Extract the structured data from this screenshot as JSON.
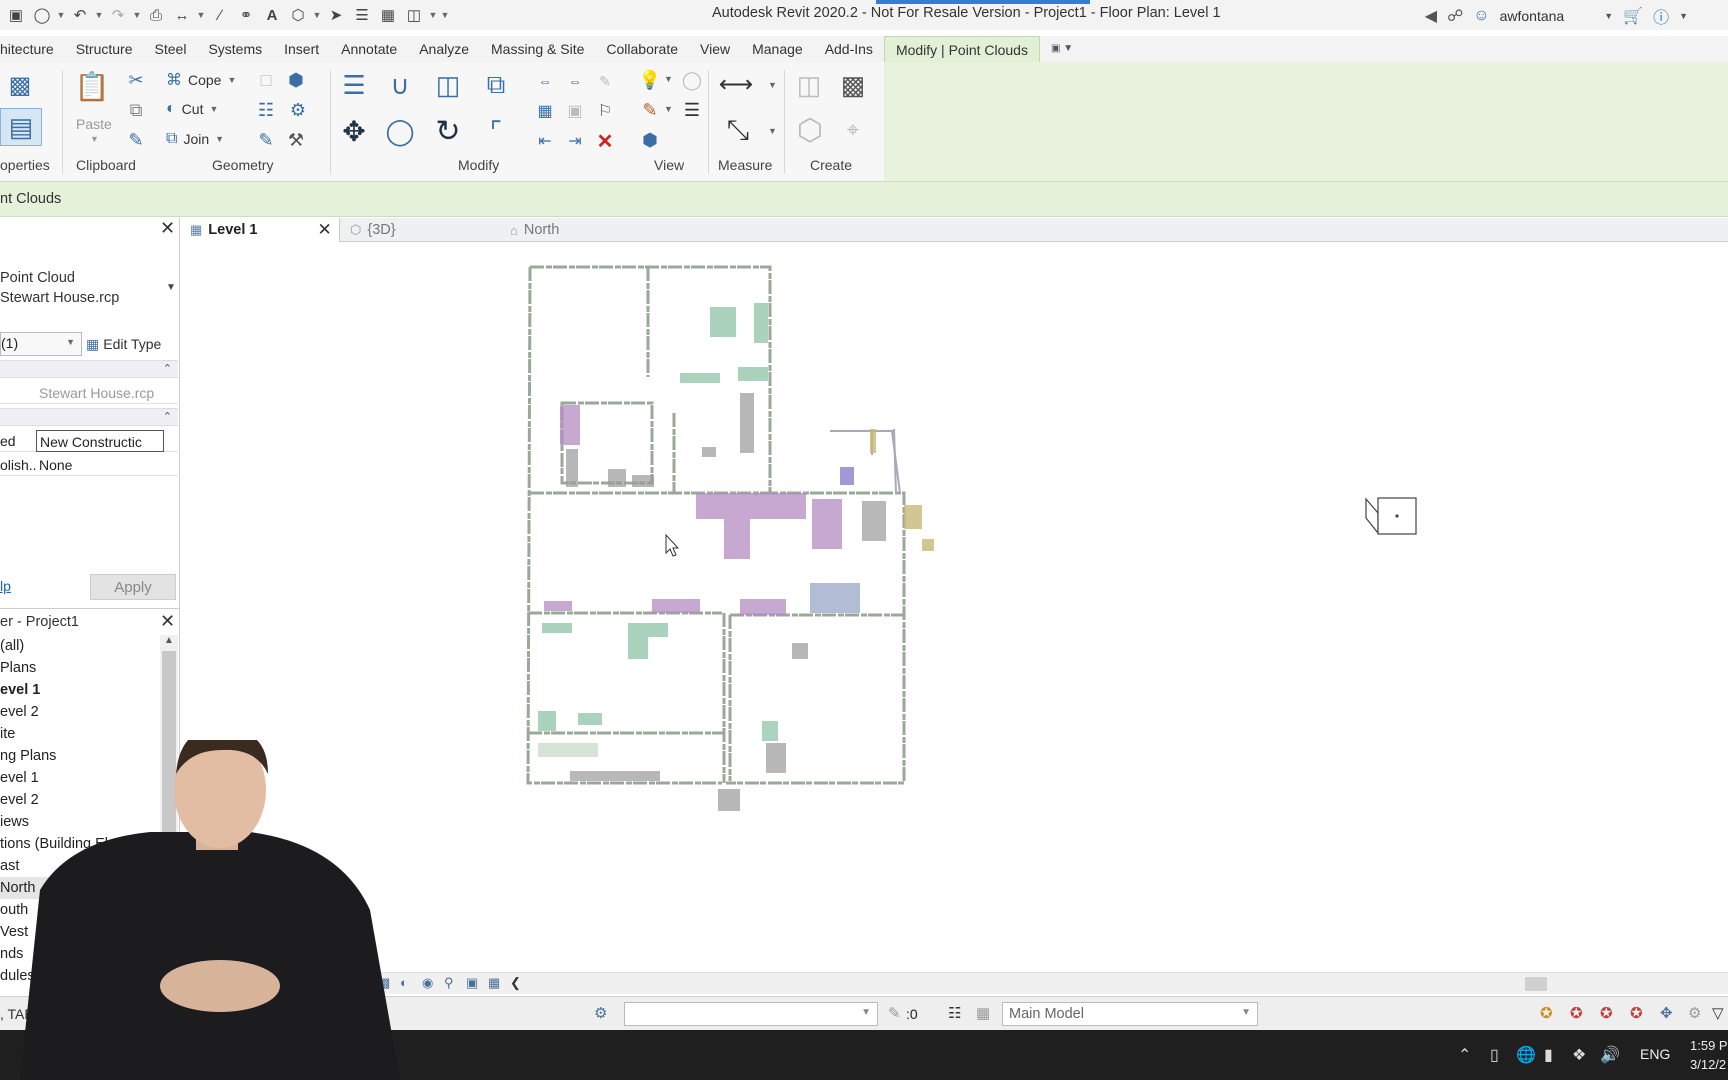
{
  "window": {
    "title": "Autodesk Revit 2020.2 - Not For Resale Version - Project1 - Floor Plan: Level 1",
    "user": "awfontana"
  },
  "ribbon_tabs": [
    "hitecture",
    "Structure",
    "Steel",
    "Systems",
    "Insert",
    "Annotate",
    "Analyze",
    "Massing & Site",
    "Collaborate",
    "View",
    "Manage",
    "Add-Ins",
    "Modify | Point Clouds"
  ],
  "ribbon": {
    "groups": {
      "properties": "operties",
      "clipboard": "Clipboard",
      "geometry": "Geometry",
      "modify": "Modify",
      "view": "View",
      "measure": "Measure",
      "create": "Create"
    },
    "paste": "Paste",
    "cope": "Cope",
    "cut": "Cut",
    "join": "Join"
  },
  "context_bar": "nt Clouds",
  "properties": {
    "type_line1": "Point Cloud",
    "type_line2": "Stewart House.rcp",
    "instance_filter": "(1)",
    "edit_type": "Edit Type",
    "rows": [
      {
        "key": "",
        "value": "Stewart House.rcp"
      },
      {
        "key": "ed",
        "value": "New Constructic"
      },
      {
        "key": "olish...",
        "value": "None"
      }
    ],
    "help": "lp",
    "apply": "Apply"
  },
  "browser": {
    "title": "er - Project1",
    "items": [
      {
        "label": " (all)"
      },
      {
        "label": " Plans"
      },
      {
        "label": "evel 1"
      },
      {
        "label": "evel 2"
      },
      {
        "label": "ite"
      },
      {
        "label": "ng Plans"
      },
      {
        "label": "evel 1"
      },
      {
        "label": "evel 2"
      },
      {
        "label": "iews"
      },
      {
        "label": "tions (Building Elevatio"
      },
      {
        "label": "ast"
      },
      {
        "label": "North"
      },
      {
        "label": "outh"
      },
      {
        "label": "Vest"
      },
      {
        "label": "nds"
      },
      {
        "label": "dules/Qua"
      }
    ]
  },
  "view_tabs": [
    {
      "label": "Level 1"
    },
    {
      "label": "{3D}"
    },
    {
      "label": "North"
    }
  ],
  "status": {
    "hint": ", TAB fo",
    "selection_count": ":0",
    "model": "Main Model"
  },
  "taskbar": {
    "lang": "ENG",
    "time": "1:59 P",
    "date": "3/12/2"
  },
  "colors": {
    "ribbon_active": "#e3f0d8",
    "context_bar": "#e6f1da",
    "taskbar": "#1f1f1f"
  }
}
